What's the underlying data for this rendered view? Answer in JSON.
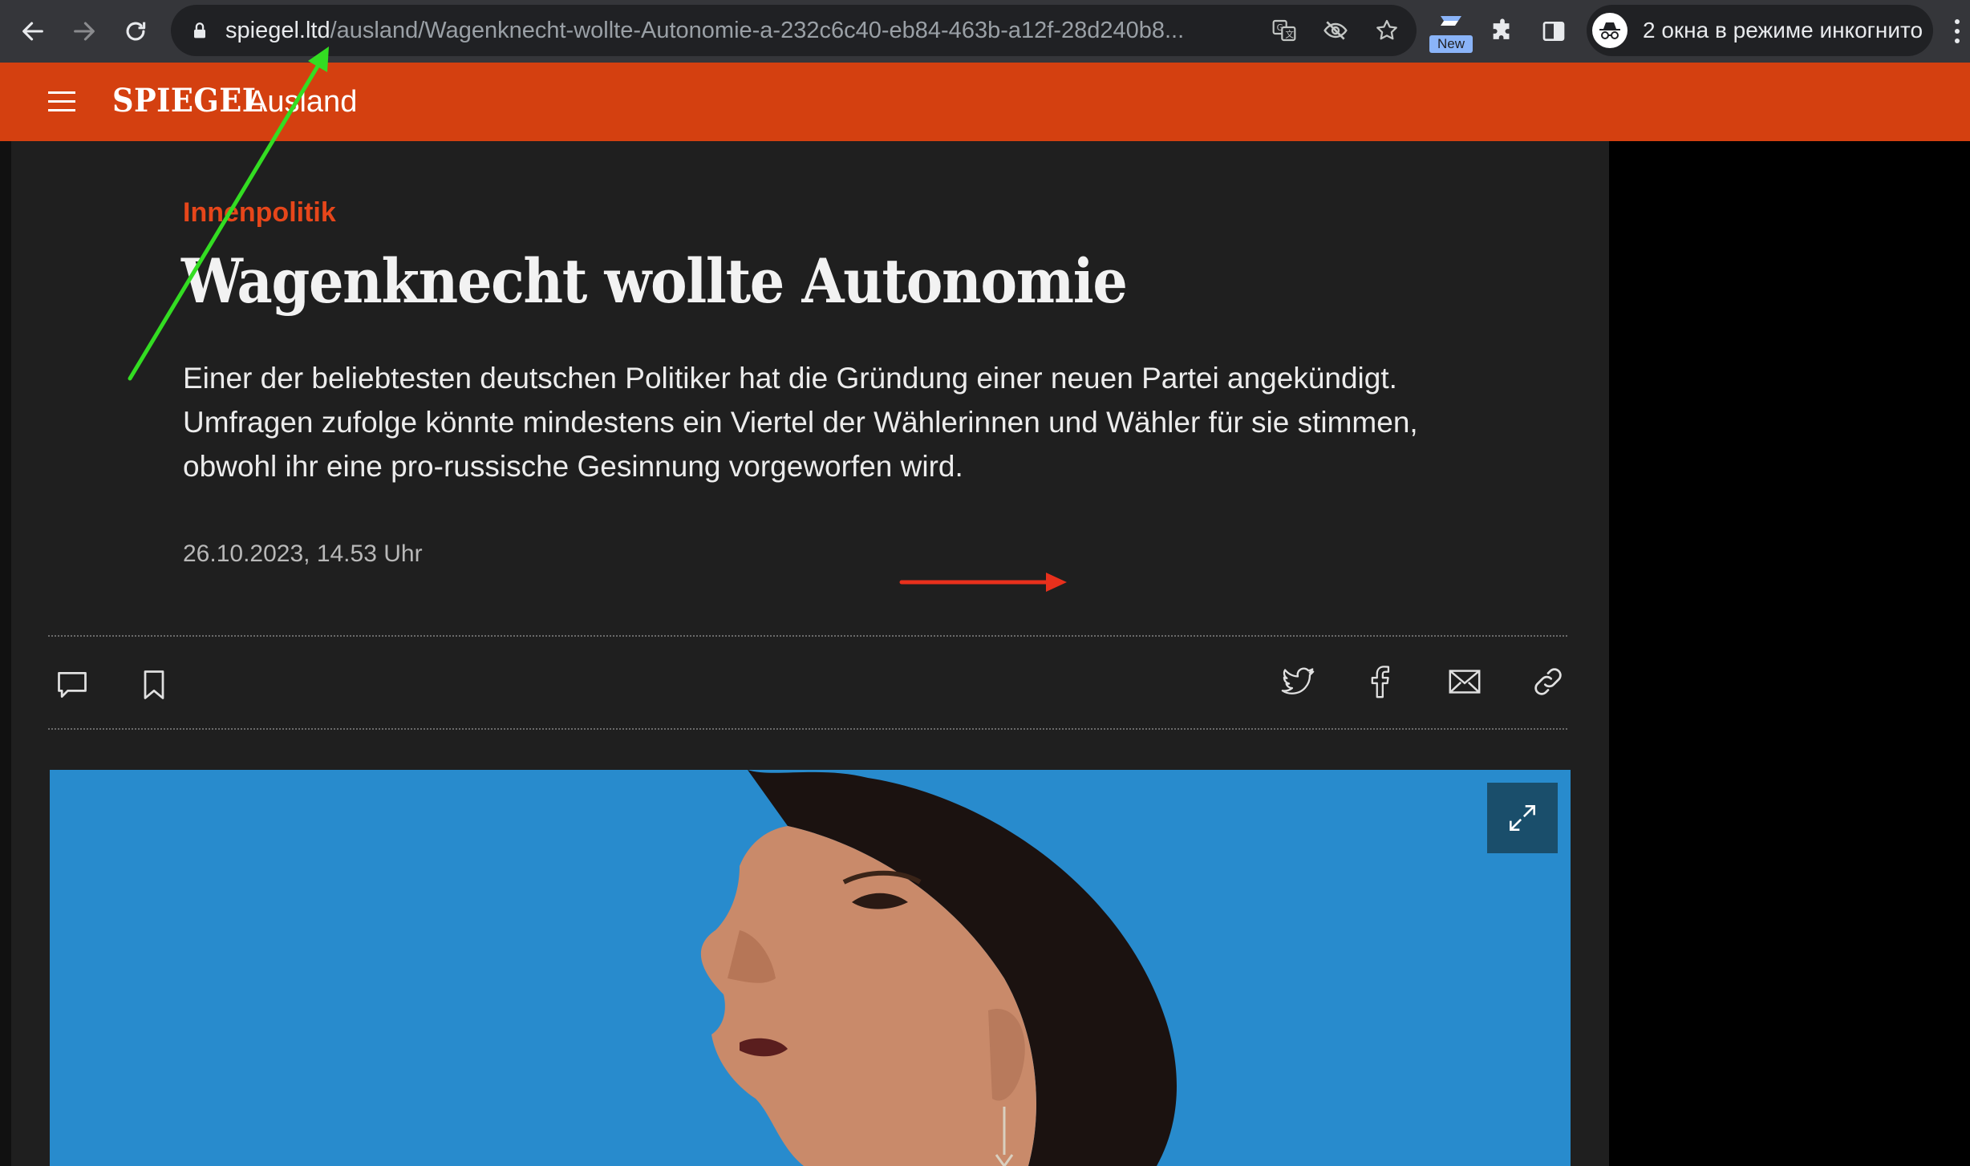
{
  "browser": {
    "url_host": "spiegel.ltd",
    "url_path": "/ausland/Wagenknecht-wollte-Autonomie-a-232c6c40-eb84-463b-a12f-28d240b8...",
    "extension_badge": "New",
    "incognito_label": "2 окна в режиме инкогнито",
    "icons": [
      "back-icon",
      "forward-icon",
      "reload-icon",
      "lock-icon",
      "translate-icon",
      "eye-off-icon",
      "star-icon",
      "extension-new-icon",
      "puzzle-icon",
      "sidepanel-icon",
      "incognito-icon",
      "kebab-menu-icon"
    ]
  },
  "site": {
    "logo": "SPIEGEL",
    "section": "Ausland",
    "brand_color": "#d44010"
  },
  "article": {
    "kicker": "Innenpolitik",
    "headline": "Wagenknecht wollte Autonomie",
    "lead": "Einer der beliebtesten deutschen Politiker hat die Gründung einer neuen Partei angekündigt. Umfragen zufolge könnte mindestens ein Viertel der Wählerinnen und Wähler für sie stimmen, obwohl ihr eine pro-russische Gesinnung vorgeworfen wird.",
    "dateline": "26.10.2023, 14.53 Uhr",
    "actions": [
      "comment-icon",
      "bookmark-icon",
      "twitter-icon",
      "facebook-icon",
      "mail-icon",
      "link-icon"
    ],
    "kicker_color": "#e6461a",
    "hero_background": "#2a8fd0"
  },
  "annotations": {
    "green_arrow_color": "#33dd22",
    "red_arrow_color": "#e8301c"
  }
}
